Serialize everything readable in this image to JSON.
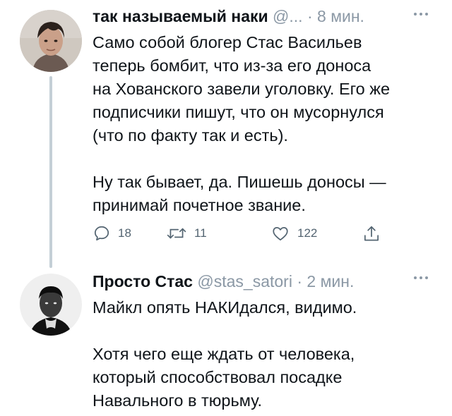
{
  "tweets": [
    {
      "author": {
        "name": "так называемый наки",
        "handle": "@...",
        "avatar_icon": "user-avatar-photo"
      },
      "separator": "·",
      "time": "8 мин.",
      "more_icon": "more-dots-icon",
      "paragraphs": [
        [
          "Само собой блогер Стас Васильев",
          "теперь бомбит, что из-за его доноса",
          "на Хованского завели уголовку. Его же",
          "подписчики пишут, что он мусорнулся",
          "(что по факту так и есть)."
        ],
        [
          "Ну так бывает, да. Пишешь доносы —",
          "принимай почетное звание."
        ]
      ],
      "actions": {
        "reply_count": "18",
        "retweet_count": "11",
        "like_count": "122"
      }
    },
    {
      "author": {
        "name": "Просто Стас",
        "handle": "@stas_satori",
        "avatar_icon": "user-avatar-photo"
      },
      "separator": "·",
      "time": "2 мин.",
      "more_icon": "more-dots-icon",
      "paragraphs": [
        [
          "Майкл опять НАКИдался, видимо."
        ],
        [
          "Хотя чего еще ждать от человека,",
          "который способствовал посадке",
          "Навального в тюрьму."
        ]
      ]
    }
  ],
  "colors": {
    "text": "#0f1419",
    "secondary": "#8b98a5",
    "icon": "#536471",
    "thread_line": "#c4cfd6"
  }
}
